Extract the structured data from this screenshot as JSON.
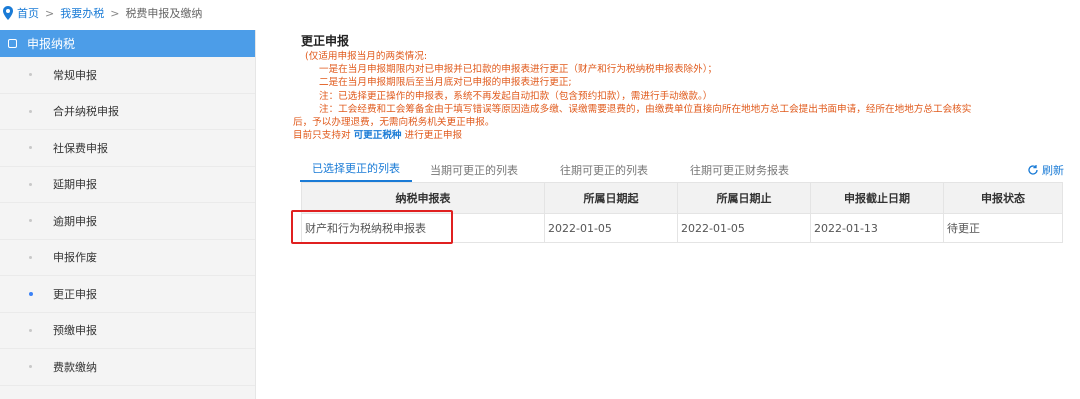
{
  "breadcrumb": {
    "home": "首页",
    "sep1": ">",
    "level2": "我要办税",
    "sep2": ">",
    "current": "税费申报及缴纳"
  },
  "sidebar": {
    "header": "申报纳税",
    "items": [
      {
        "label": "常规申报"
      },
      {
        "label": "合并纳税申报"
      },
      {
        "label": "社保费申报"
      },
      {
        "label": "延期申报"
      },
      {
        "label": "逾期申报"
      },
      {
        "label": "申报作废"
      },
      {
        "label": "更正申报"
      },
      {
        "label": "预缴申报"
      },
      {
        "label": "费款缴纳"
      }
    ],
    "active_index": 6
  },
  "main": {
    "title": "更正申报",
    "notes": [
      "(仅适用申报当月的两类情况:",
      "一是在当月申报期限内对已申报并已扣款的申报表进行更正（财产和行为税纳税申报表除外）；",
      "二是在当月申报期限后至当月底对已申报的申报表进行更正;",
      "注：已选择更正操作的申报表，系统不再发起自动扣款（包含预约扣款），需进行手动缴款。）",
      "注：工会经费和工会筹备金由于填写错误等原因造成多缴、误缴需要退费的，由缴费单位直接向所在地地方总工会提出书面申请，经所在地地方总工会核实",
      "后，予以办理退费，无需向税务机关更正申报。"
    ],
    "support_prefix": "目前只支持对",
    "support_link": "可更正税种",
    "support_suffix": "进行更正申报",
    "tabs": [
      "已选择更正的列表",
      "当期可更正的列表",
      "往期可更正的列表",
      "往期可更正财务报表"
    ],
    "active_tab": 0,
    "refresh_label": "刷新",
    "table": {
      "headers": [
        "纳税申报表",
        "所属日期起",
        "所属日期止",
        "申报截止日期",
        "申报状态"
      ],
      "rows": [
        [
          "财产和行为税纳税申报表",
          "2022-01-05",
          "2022-01-05",
          "2022-01-13",
          "待更正"
        ]
      ]
    }
  },
  "colors": {
    "accent": "#1a7bd6",
    "sidebar_header": "#4c9de8",
    "note_text": "#e05a1c",
    "highlight_box": "#e02020"
  }
}
